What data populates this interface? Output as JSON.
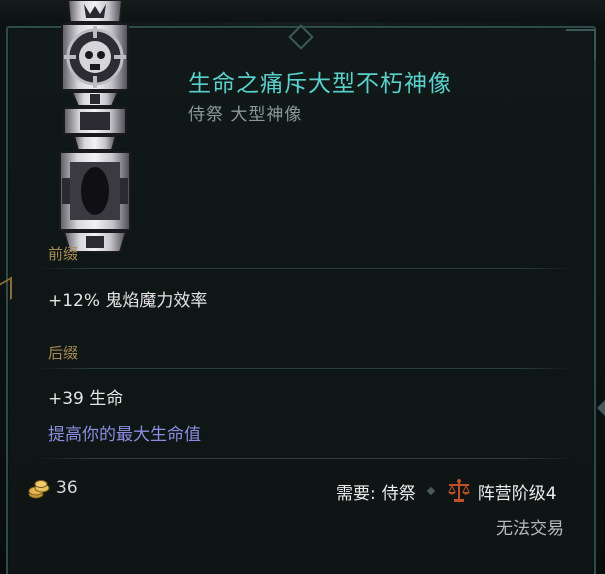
{
  "item": {
    "name": "生命之痛斥大型不朽神像",
    "type": "侍祭 大型神像"
  },
  "prefix": {
    "label": "前缀",
    "stat": "+12% 鬼焰魔力效率"
  },
  "suffix": {
    "label": "后缀",
    "stat": "+39 生命",
    "description": "提高你的最大生命值"
  },
  "footer": {
    "gold_icon": "gold-coins-icon",
    "gold_value": "36",
    "requirement_label": "需要:",
    "requirement_class": "侍祭",
    "faction_icon": "scale-icon",
    "faction_rank": "阵营阶级4",
    "tradeable": "无法交易"
  },
  "colors": {
    "item_name": "#5ad0cc",
    "item_type": "#8a9898",
    "section_label": "#a68a55",
    "affix_text": "#e4e4e4",
    "description_text": "#8a8ee0",
    "panel_border": "#2f4a4a"
  }
}
